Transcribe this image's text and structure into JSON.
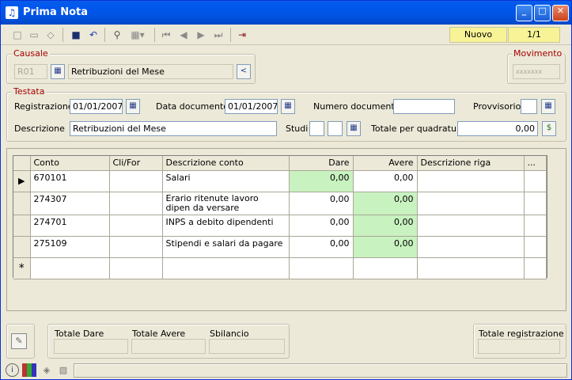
{
  "window": {
    "title": "Prima Nota",
    "minimize_label": "_",
    "maximize_label": "□",
    "close_label": "✕"
  },
  "toolbar": {
    "status": "Nuovo",
    "record": "1/1",
    "icons": [
      "new-icon",
      "open-icon",
      "eraser-icon",
      "save-icon",
      "undo-icon",
      "find-icon",
      "grid-view-icon",
      "first-icon",
      "prev-icon",
      "next-icon",
      "last-icon",
      "exit-icon"
    ]
  },
  "causale": {
    "legend": "Causale",
    "code": "R01",
    "description": "Retribuzioni del Mese",
    "back": "<"
  },
  "movimento": {
    "legend": "Movimento",
    "value": "xxxxxxx"
  },
  "testata": {
    "legend": "Testata",
    "registrazione_label": "Registrazione",
    "registrazione": "01/01/2007",
    "data_documento_label": "Data documento",
    "data_documento": "01/01/2007",
    "numero_documento_label": "Numero documento",
    "numero_documento": "",
    "provvisorio_label": "Provvisorio",
    "descrizione_label": "Descrizione",
    "descrizione": "Retribuzioni del Mese",
    "studi_label": "Studi",
    "totale_label": "Totale per quadratura",
    "totale": "0,00"
  },
  "grid": {
    "columns": [
      "Conto",
      "Cli/For",
      "Descrizione conto",
      "Dare",
      "Avere",
      "Descrizione riga",
      "..."
    ],
    "rows": [
      {
        "conto": "670101",
        "clifor": "",
        "descrizione": "Salari",
        "dare": "0,00",
        "avere": "0,00",
        "riga": ""
      },
      {
        "conto": "274307",
        "clifor": "",
        "descrizione": "Erario ritenute lavoro dipen da versare",
        "dare": "0,00",
        "avere": "0,00",
        "riga": ""
      },
      {
        "conto": "274701",
        "clifor": "",
        "descrizione": "INPS a debito dipendenti",
        "dare": "0,00",
        "avere": "0,00",
        "riga": ""
      },
      {
        "conto": "275109",
        "clifor": "",
        "descrizione": "Stipendi e salari da pagare",
        "dare": "0,00",
        "avere": "0,00",
        "riga": ""
      }
    ],
    "new_row_marker": "*",
    "current_row_marker": "▶"
  },
  "totals": {
    "dare_label": "Totale Dare",
    "avere_label": "Totale Avere",
    "sbilancio_label": "Sbilancio",
    "registrazione_label": "Totale registrazione",
    "dare": "",
    "avere": "",
    "sbilancio": "",
    "registrazione": ""
  },
  "colors": {
    "title_blue": "#0058ee",
    "status_yellow": "#f7f396",
    "legend_red": "#a40000",
    "cell_green": "#c8f2c0"
  }
}
